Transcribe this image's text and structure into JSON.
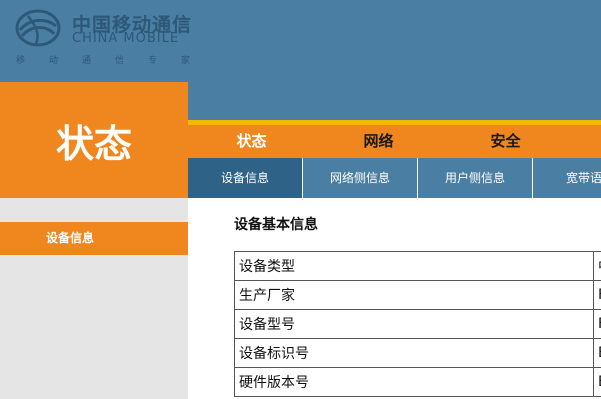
{
  "logo": {
    "name_cn": "中国移动通信",
    "name_en": "CHINA MOBILE",
    "slogan": "移动通信专家"
  },
  "left_header": "状态",
  "main_nav": [
    {
      "label": "状态"
    },
    {
      "label": "网络"
    },
    {
      "label": "安全"
    }
  ],
  "sub_nav": [
    {
      "label": "设备信息"
    },
    {
      "label": "网络侧信息"
    },
    {
      "label": "用户侧信息"
    },
    {
      "label": "宽带语音"
    }
  ],
  "sidebar": {
    "items": [
      {
        "label": "设备信息"
      }
    ]
  },
  "main": {
    "section_title": "设备基本信息",
    "rows": [
      {
        "label": "设备类型",
        "value": "中"
      },
      {
        "label": "生产厂家",
        "value": "F"
      },
      {
        "label": "设备型号",
        "value": "F"
      },
      {
        "label": "设备标识号",
        "value": "E"
      },
      {
        "label": "硬件版本号",
        "value": "E"
      }
    ]
  },
  "colors": {
    "header_blue": "#4a7ea3",
    "accent_orange": "#f0861e",
    "highlight_yellow": "#f5b800",
    "active_subtab": "#2f6287",
    "sidebar_gray": "#e5e5e5"
  }
}
